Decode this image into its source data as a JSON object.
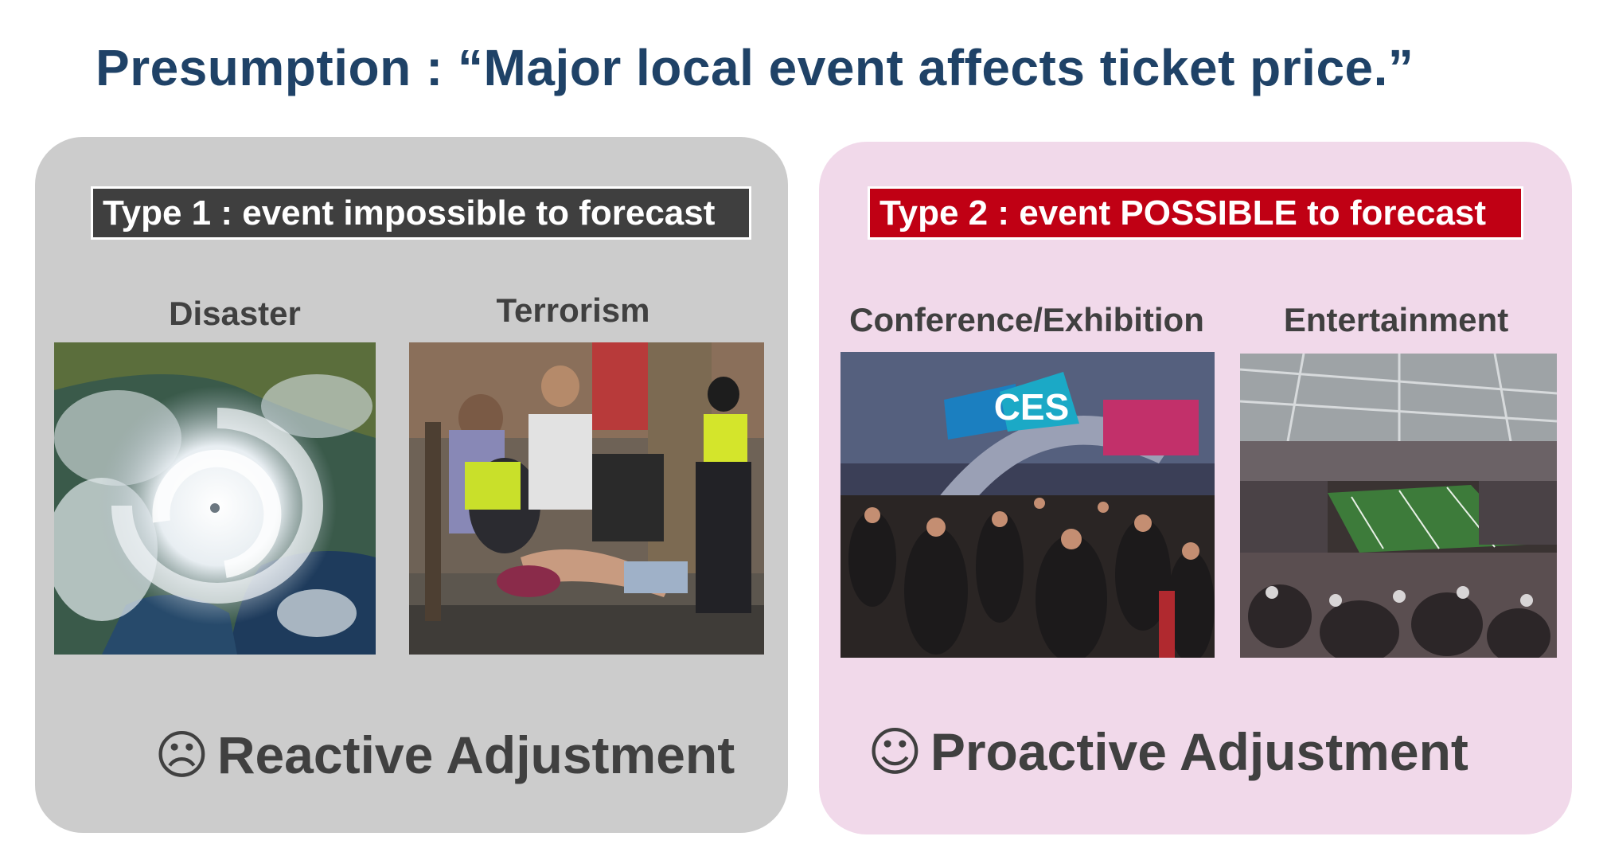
{
  "title": "Presumption : “Major local event affects ticket price.”",
  "left_panel": {
    "type_label": "Type 1 : event impossible to forecast",
    "categories": [
      {
        "label": "Disaster",
        "image": "hurricane satellite image"
      },
      {
        "label": "Terrorism",
        "image": "street emergency scene"
      }
    ],
    "outcome_icon": "☹",
    "outcome": "Reactive Adjustment",
    "colors": {
      "panel": "#cccccc",
      "label_bg": "#3f3f3f"
    }
  },
  "right_panel": {
    "type_label": "Type 2 : event POSSIBLE to forecast",
    "categories": [
      {
        "label": "Conference/Exhibition",
        "image": "CES exhibition crowd",
        "sign": "CES"
      },
      {
        "label": "Entertainment",
        "image": "football stadium"
      }
    ],
    "outcome_icon": "☺",
    "outcome": "Proactive Adjustment",
    "colors": {
      "panel": "#f1d9ea",
      "label_bg": "#c00014"
    }
  },
  "colors": {
    "title": "#1f4267",
    "text": "#404040"
  }
}
